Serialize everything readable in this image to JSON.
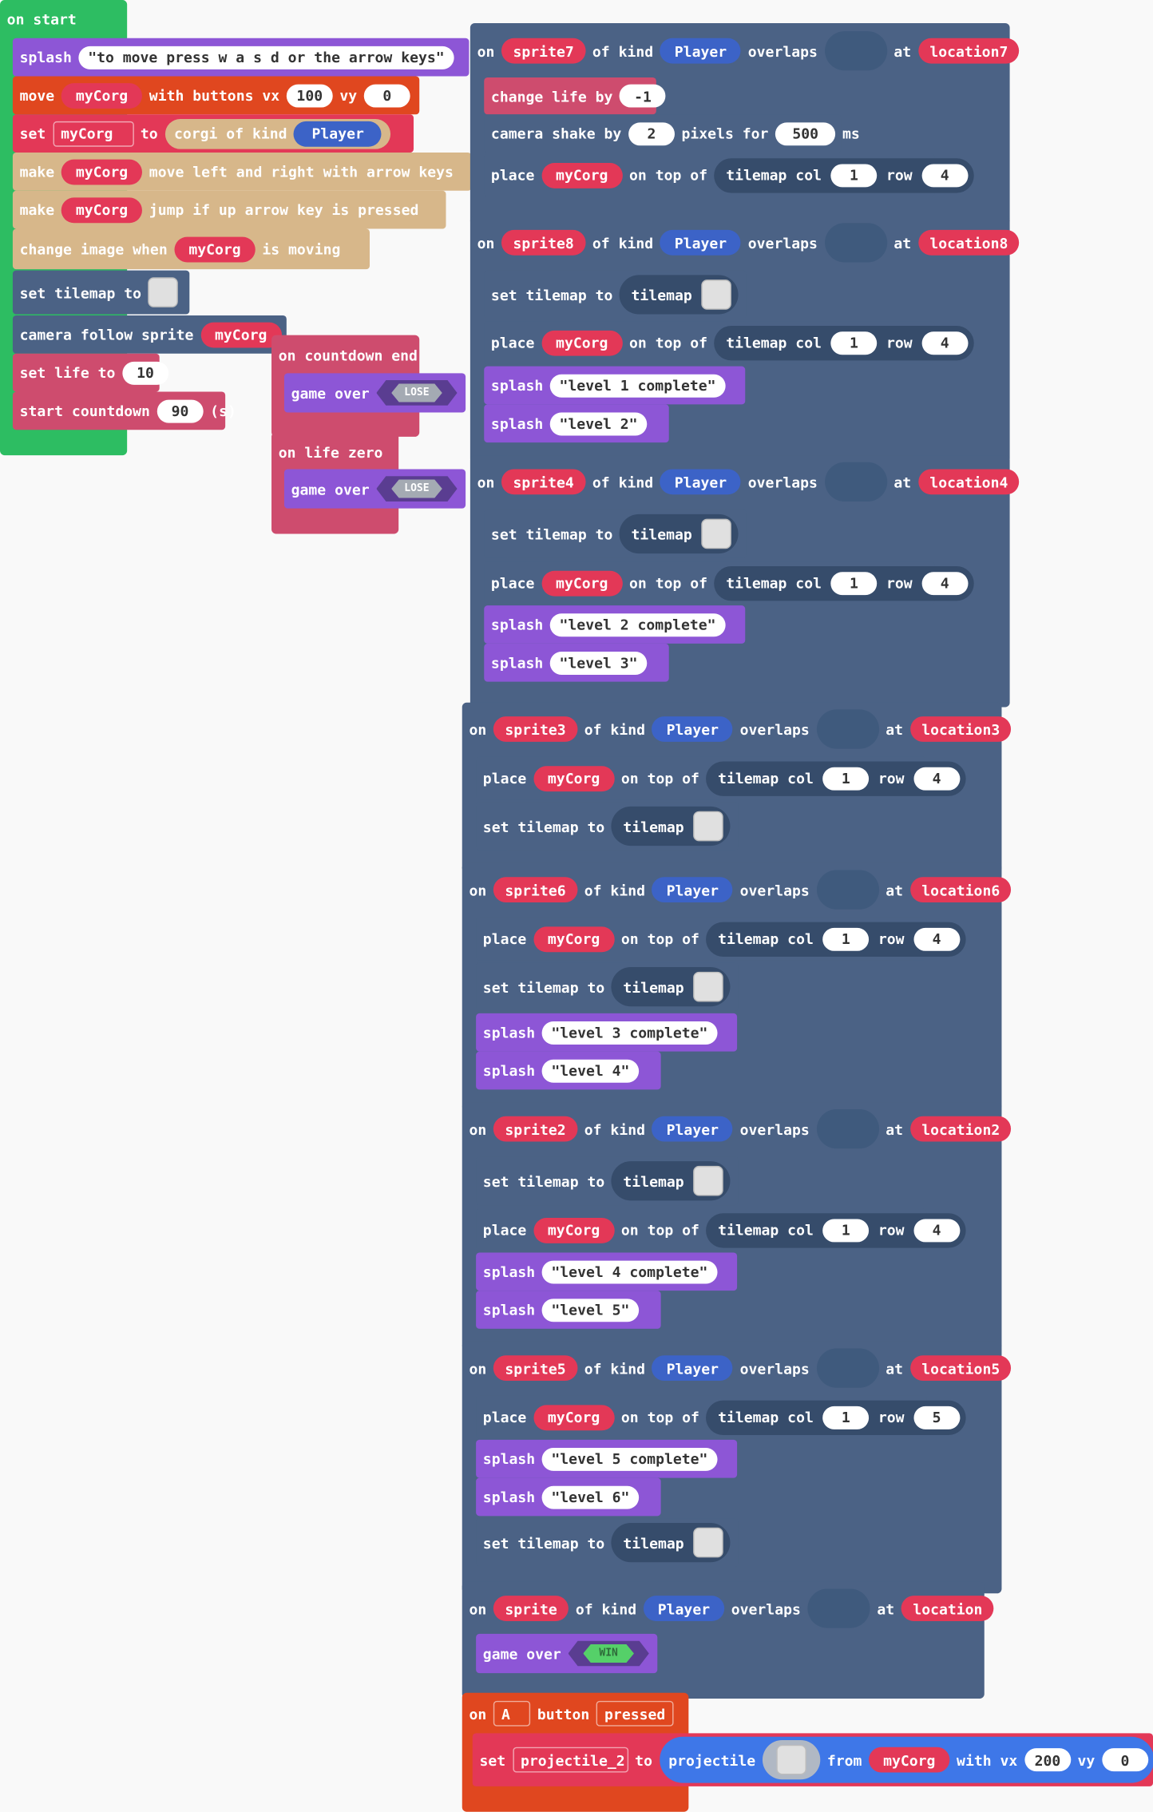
{
  "colors": {
    "loops": "#2dbd62",
    "sprites": "#4b6285",
    "sprite_dark": "#3f5a7d",
    "looks": "#8d56d6",
    "controller": "#e0471f",
    "scene": "#ce4c6e",
    "game": "#d7b78a",
    "var": "#e33857",
    "kind": "#3c63c7",
    "proj": "#3e77e8",
    "win": "#55d069",
    "lose": "#a4aab3"
  },
  "on_start": {
    "hat": "on start",
    "splash": {
      "label": "splash",
      "text": "\"to move press w a s d or the arrow keys\""
    },
    "move": {
      "label": "move",
      "sprite": "myCorg",
      "with": "with buttons vx",
      "vx": "100",
      "vy_label": "vy",
      "vy": "0"
    },
    "set": {
      "label": "set",
      "var": "myCorg",
      "to": "to",
      "desc": "corgi of kind",
      "kind": "Player"
    },
    "make1": {
      "label": "make",
      "sprite": "myCorg",
      "text": "move left and right with arrow keys"
    },
    "make2": {
      "label": "make",
      "sprite": "myCorg",
      "text": "jump if up arrow key is pressed"
    },
    "change_image": {
      "label": "change image when",
      "sprite": "myCorg",
      "text": "is moving"
    },
    "set_tilemap": {
      "label": "set tilemap to"
    },
    "camera": {
      "label": "camera follow sprite",
      "sprite": "myCorg"
    },
    "set_life": {
      "label": "set life to",
      "value": "10"
    },
    "countdown": {
      "label": "start countdown",
      "value": "90",
      "unit": "(s)"
    }
  },
  "countdown_end": {
    "hat": "on countdown end",
    "game_over": "game over",
    "result": "LOSE"
  },
  "life_zero": {
    "hat": "on life zero",
    "game_over": "game over",
    "result": "LOSE"
  },
  "common": {
    "on": "on",
    "of_kind": "of kind",
    "overlaps": "overlaps",
    "at": "at",
    "place": "place",
    "on_top": "on top of",
    "tilemap_col": "tilemap col",
    "row": "row",
    "set_tilemap": "set tilemap to",
    "tilemap": "tilemap",
    "splash": "splash",
    "kind": "Player",
    "sprite": "myCorg"
  },
  "event7": {
    "sprite": "sprite7",
    "location": "location7",
    "change_life": "change life by",
    "life_val": "-1",
    "shake": "camera shake by",
    "shake_val": "2",
    "pixels_for": "pixels for",
    "ms_val": "500",
    "ms": "ms",
    "col": "1",
    "row": "4"
  },
  "event8": {
    "sprite": "sprite8",
    "location": "location8",
    "col": "1",
    "row": "4",
    "splash1": "\"level 1 complete\"",
    "splash2": "\"level 2\""
  },
  "event4": {
    "sprite": "sprite4",
    "location": "location4",
    "col": "1",
    "row": "4",
    "splash1": "\"level 2 complete\"",
    "splash2": "\"level 3\""
  },
  "event3": {
    "sprite": "sprite3",
    "location": "location3",
    "col": "1",
    "row": "4"
  },
  "event6": {
    "sprite": "sprite6",
    "location": "location6",
    "col": "1",
    "row": "4",
    "splash1": "\"level 3 complete\"",
    "splash2": "\"level 4\""
  },
  "event2": {
    "sprite": "sprite2",
    "location": "location2",
    "col": "1",
    "row": "4",
    "splash1": "\"level 4 complete\"",
    "splash2": "\"level 5\""
  },
  "event5": {
    "sprite": "sprite5",
    "location": "location5",
    "col": "1",
    "row": "5",
    "splash1": "\"level 5 complete\"",
    "splash2": "\"level 6\""
  },
  "event_win": {
    "sprite": "sprite",
    "location": "location",
    "game_over": "game over",
    "result": "WIN"
  },
  "button_event": {
    "on": "on",
    "button": "A",
    "button_label": "button",
    "pressed": "pressed",
    "set": "set",
    "var": "projectile_2",
    "to": "to",
    "projectile": "projectile",
    "from": "from",
    "sprite": "myCorg",
    "vx_label": "with vx",
    "vx": "200",
    "vy_label": "vy",
    "vy": "0"
  }
}
